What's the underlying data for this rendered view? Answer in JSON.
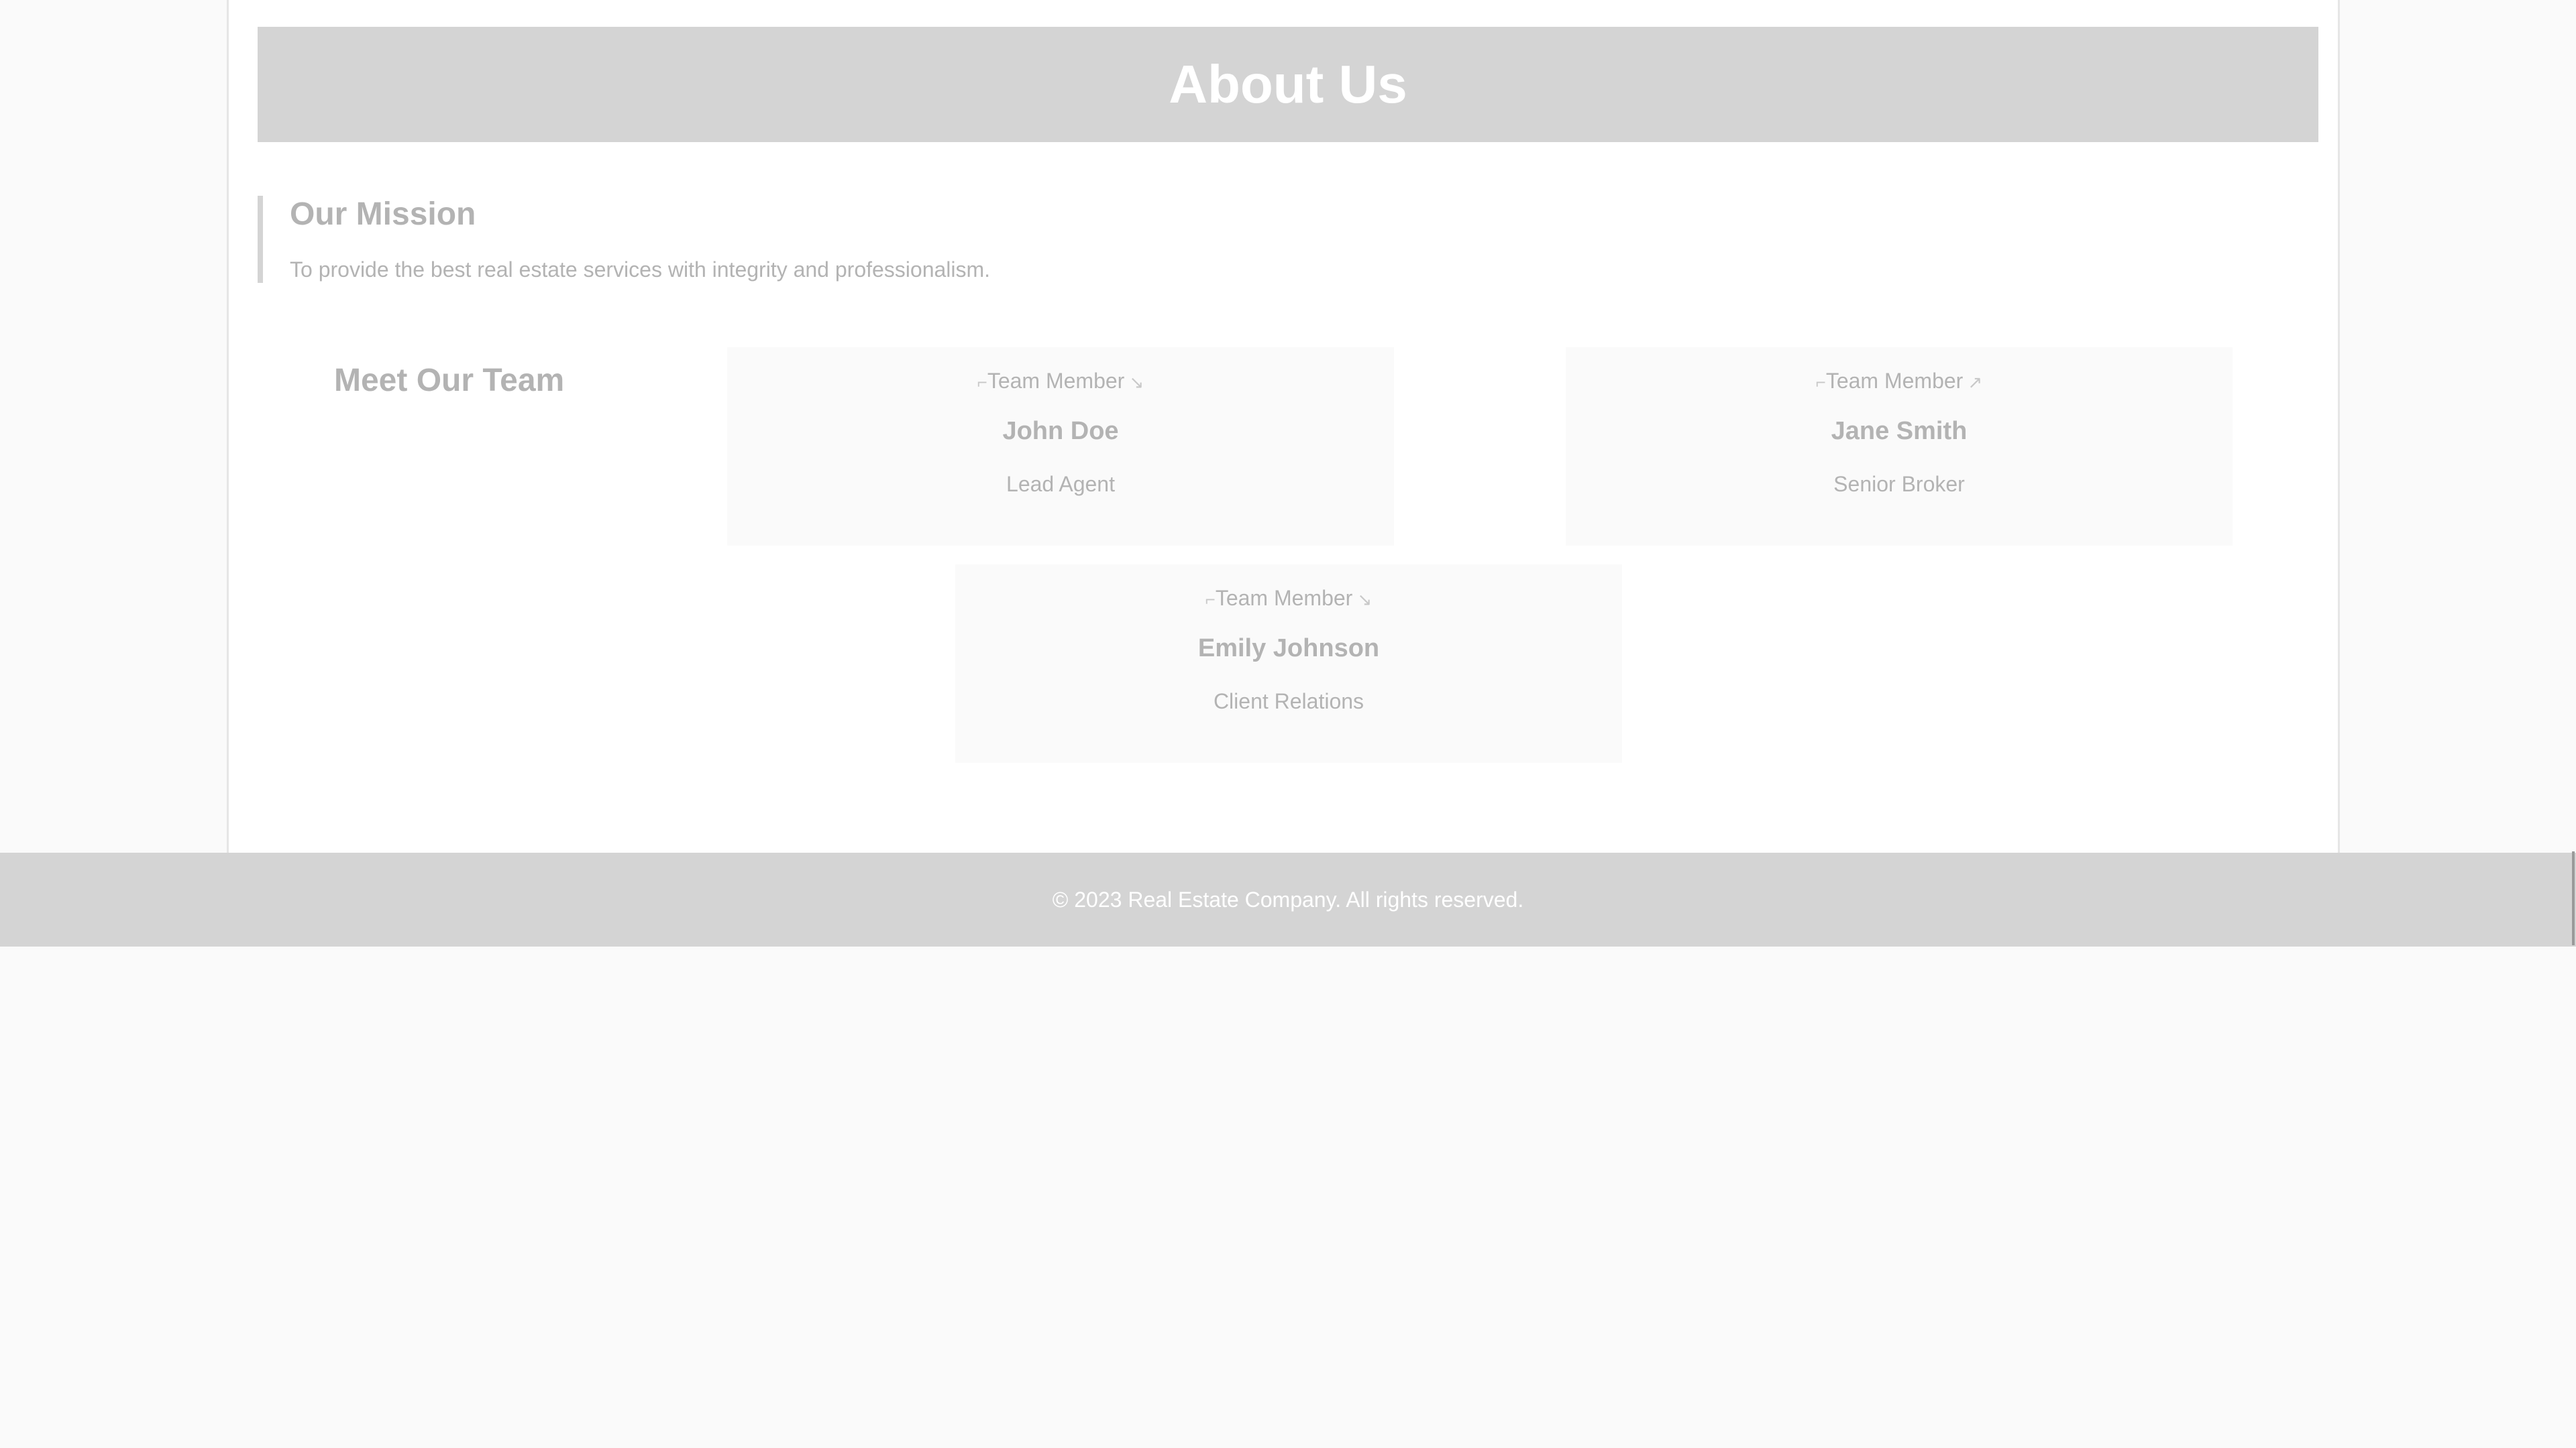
{
  "hero": {
    "title": "About Us"
  },
  "mission": {
    "heading": "Our Mission",
    "text": "To provide the best real estate services with integrity and professionalism."
  },
  "team": {
    "heading": "Meet Our Team",
    "members": [
      {
        "photo_alt": "Team Member",
        "name": "John Doe",
        "role": "Lead Agent"
      },
      {
        "photo_alt": "Team Member",
        "name": "Jane Smith",
        "role": "Senior Broker"
      },
      {
        "photo_alt": "Team Member",
        "name": "Emily Johnson",
        "role": "Client Relations"
      }
    ]
  },
  "footer": {
    "text": "© 2023 Real Estate Company. All rights reserved."
  },
  "icons": {
    "broken_image": "broken-image-icon"
  },
  "colors": {
    "banner": "#d4d4d4",
    "muted_text": "#b3b3b3",
    "page_bg": "#fafafa"
  }
}
